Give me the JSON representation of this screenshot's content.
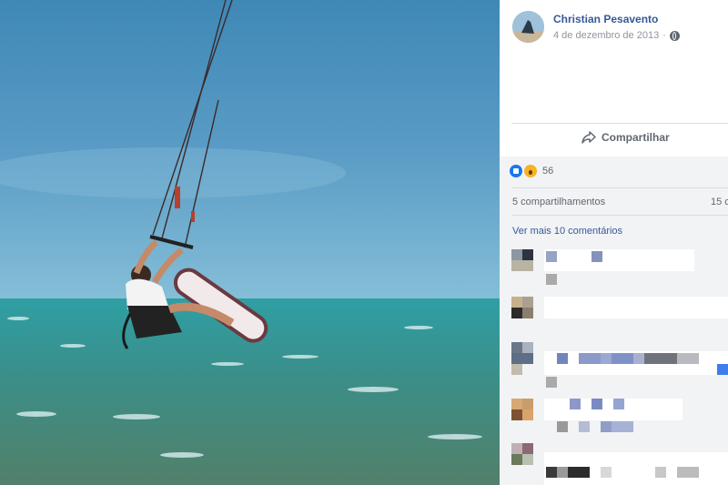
{
  "post": {
    "author": "Christian Pesavento",
    "date": "4 de dezembro de 2013",
    "separator": "·",
    "privacy_icon": "globe-icon"
  },
  "actions": {
    "share_label": "Compartilhar",
    "share_icon": "share-arrow-icon"
  },
  "reactions": {
    "types": [
      "like",
      "wow"
    ],
    "count": "56"
  },
  "stats": {
    "shares": "5 compartilhamentos",
    "comments": "15 c"
  },
  "comments": {
    "more_label": "Ver mais 10 comentários",
    "items_visible": 5,
    "note": "comment contents are pixelated"
  },
  "colors": {
    "link": "#385898",
    "meta": "#90949c",
    "panel_bg": "#f2f3f5",
    "sky": "#4f8fc0",
    "sea": "#2f8a8c"
  }
}
